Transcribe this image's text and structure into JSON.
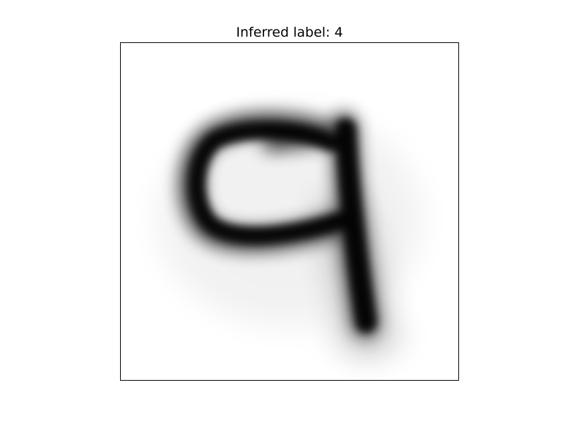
{
  "figure": {
    "title": "Inferred label: 4"
  },
  "image": {
    "colormap": "gray_r",
    "background_color": "#ffffff",
    "ink_color": "#000000"
  }
}
